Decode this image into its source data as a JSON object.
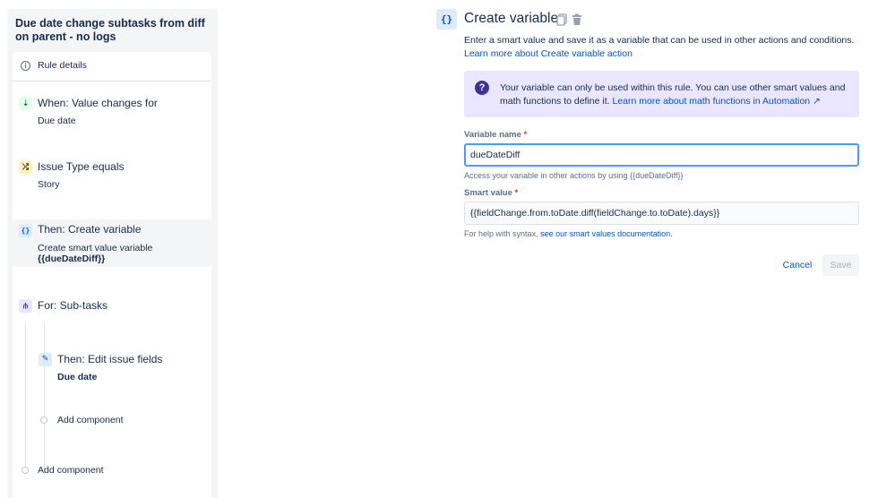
{
  "rule": {
    "title": "Due date change subtasks from diff on parent - no logs",
    "details_label": "Rule details",
    "steps": [
      {
        "title": "When: Value changes for",
        "sub": "Due date",
        "icon": "field-change-icon"
      },
      {
        "title": "Issue Type equals",
        "sub": "Story",
        "icon": "condition-icon"
      },
      {
        "title": "Then: Create variable",
        "sub": "Create smart value variable",
        "sub2": "{{dueDateDiff}}",
        "icon": "variable-icon"
      },
      {
        "title": "For: Sub-tasks",
        "icon": "branch-icon"
      },
      {
        "title": "Then: Edit issue fields",
        "sub": "Due date",
        "icon": "edit-icon"
      }
    ],
    "add_component_inner": "Add component",
    "add_component_outer": "Add component"
  },
  "editor": {
    "icon_glyph": "{}",
    "title": "Create variable",
    "description": "Enter a smart value and save it as a variable that can be used in other actions and conditions.",
    "learn_link": "Learn more about Create variable action",
    "notice": {
      "text": "Your variable can only be used within this rule. You can use other smart values and math functions to define it.",
      "link": "Learn more about math functions in Automation ↗"
    },
    "variable_name": {
      "label": "Variable name",
      "required": "*",
      "value": "dueDateDiff",
      "hint": "Access your variable in other actions by using {{dueDateDiff}}"
    },
    "smart_value": {
      "label": "Smart value",
      "required": "*",
      "value": "{{fieldChange.from.toDate.diff(fieldChange.to.toDate).days}}",
      "hint_prefix": "For help with syntax,",
      "hint_link": "see our smart values documentation."
    },
    "cancel_label": "Cancel",
    "save_label": "Save"
  },
  "colors": {
    "link": "#0052cc",
    "notice_bg": "#eae6ff",
    "focus_border": "#4c9aff",
    "selected_bg": "#f4f5f7"
  }
}
